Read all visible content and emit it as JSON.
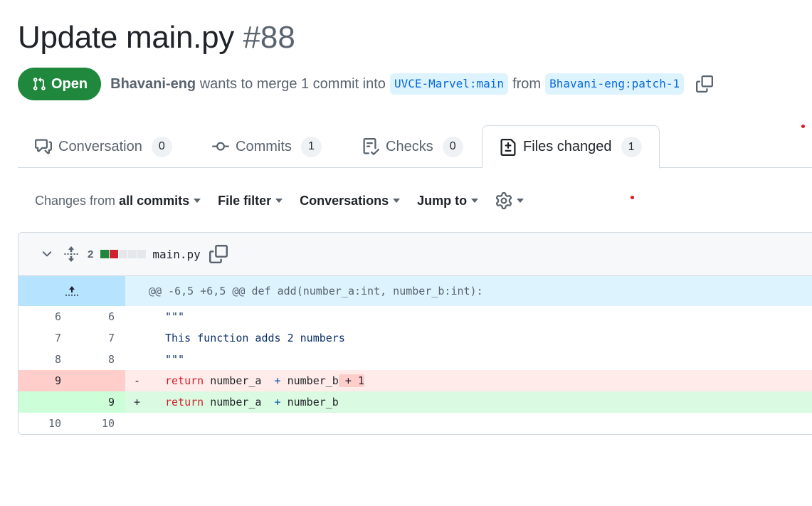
{
  "pr": {
    "title": "Update main.py",
    "number": "#88",
    "state": "Open",
    "author": "Bhavani-eng",
    "merge_text": "wants to merge 1 commit into",
    "base_branch": "UVCE-Marvel:main",
    "from_text": "from",
    "head_branch": "Bhavani-eng:patch-1",
    "copy_icon": "copy-icon",
    "colors": {
      "open": "#1f883d",
      "branch_bg": "#ddf4ff",
      "branch_fg": "#0969da"
    }
  },
  "tabs": [
    {
      "label": "Conversation",
      "count": "0",
      "icon": "comment-discussion-icon",
      "active": false
    },
    {
      "label": "Commits",
      "count": "1",
      "icon": "git-commit-icon",
      "active": false
    },
    {
      "label": "Checks",
      "count": "0",
      "icon": "checklist-icon",
      "active": false
    },
    {
      "label": "Files changed",
      "count": "1",
      "icon": "file-diff-icon",
      "active": true
    }
  ],
  "toolbar": {
    "changes_prefix": "Changes from",
    "changes_value": "all commits",
    "file_filter": "File filter",
    "conversations": "Conversations",
    "jump_to": "Jump to",
    "settings_icon": "gear-icon"
  },
  "file": {
    "changes_count": "2",
    "name": "main.py",
    "diffstat": [
      "added",
      "deleted",
      "neutral",
      "neutral",
      "neutral"
    ],
    "hunk_header": "@@ -6,5 +6,5 @@ def add(number_a:int, number_b:int):",
    "lines": [
      {
        "type": "ctx",
        "old": "6",
        "new": "6",
        "sign": "",
        "code": "\"\"\""
      },
      {
        "type": "ctx",
        "old": "7",
        "new": "7",
        "sign": "",
        "code": "This function adds 2 numbers"
      },
      {
        "type": "ctx",
        "old": "8",
        "new": "8",
        "sign": "",
        "code": "\"\"\""
      },
      {
        "type": "del",
        "old": "9",
        "new": "",
        "sign": "-",
        "kw": "return",
        "a": " number_a  ",
        "op": "+",
        "b": " number_b",
        "hl": " + 1"
      },
      {
        "type": "add",
        "old": "",
        "new": "9",
        "sign": "+",
        "kw": "return",
        "a": " number_a  ",
        "op": "+",
        "b": " number_b",
        "hl": ""
      },
      {
        "type": "ctx",
        "old": "10",
        "new": "10",
        "sign": "",
        "code": ""
      }
    ]
  }
}
